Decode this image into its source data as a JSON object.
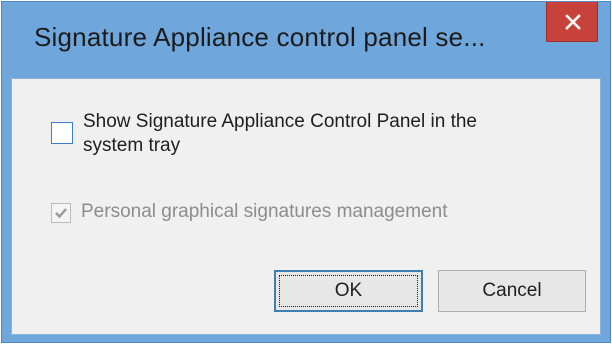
{
  "window": {
    "title": "Signature Appliance control panel se..."
  },
  "options": {
    "tray": {
      "label": "Show Signature Appliance Control Panel in the system tray",
      "checked": false,
      "enabled": true
    },
    "signatures": {
      "label": "Personal graphical signatures management",
      "checked": true,
      "enabled": false
    }
  },
  "buttons": {
    "ok_label": "OK",
    "cancel_label": "Cancel"
  },
  "icons": {
    "close": "close-icon",
    "check": "checkmark-icon"
  },
  "colors": {
    "frame": "#6fa6dc",
    "close_button": "#c7423b",
    "client_bg": "#f0f0f0",
    "checkbox_border": "#3a7dd6",
    "disabled_text": "#8d8d8d"
  }
}
